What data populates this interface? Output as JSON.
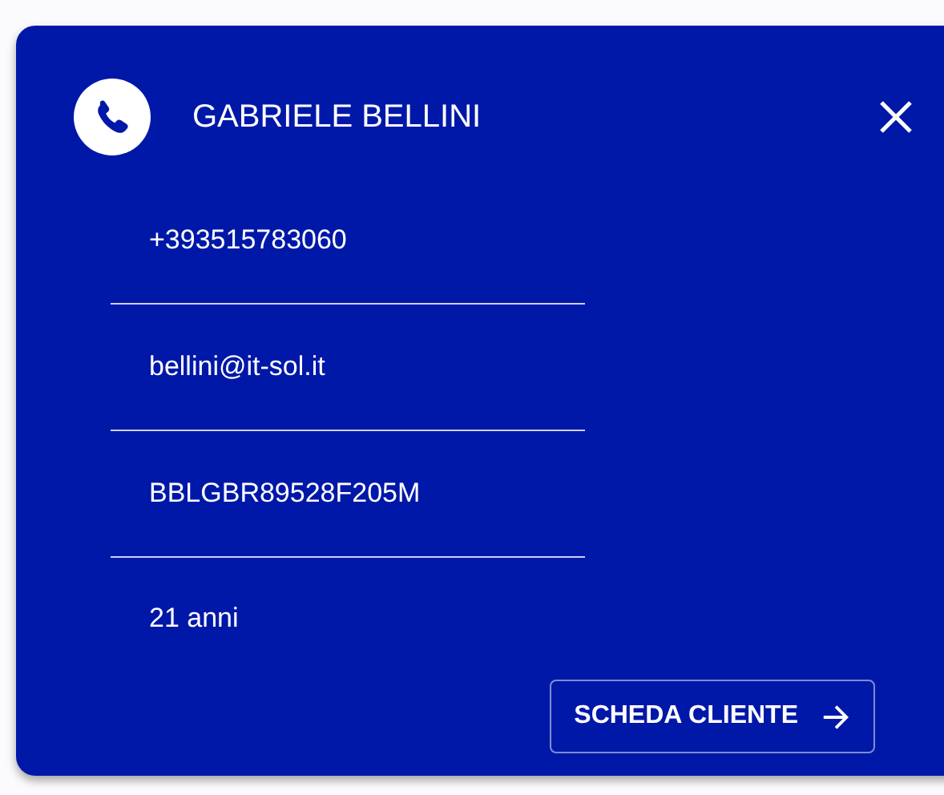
{
  "card": {
    "name": "GABRIELE BELLINI",
    "details": [
      "+393515783060",
      "bellini@it-sol.it",
      "BBLGBR89528F205M",
      "21 anni"
    ],
    "action": "SCHEDA CLIENTE"
  }
}
